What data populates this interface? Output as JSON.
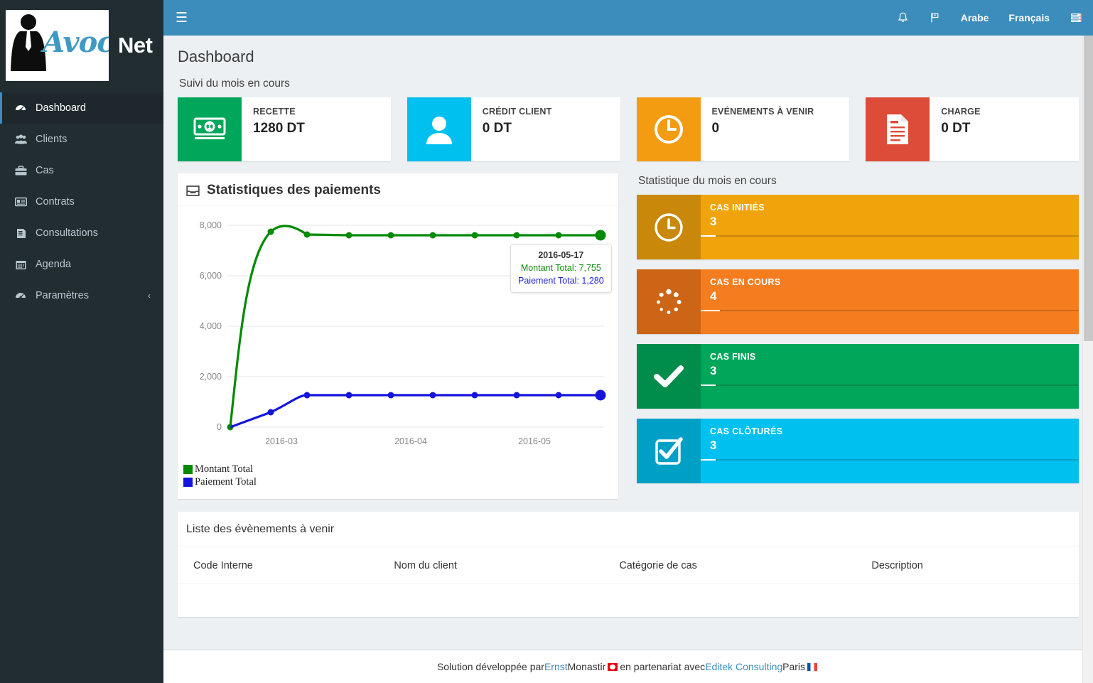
{
  "brand": {
    "script_text": "Avoca",
    "net_text": "Net"
  },
  "sidebar": {
    "items": [
      {
        "label": "Dashboard",
        "icon": "dashboard-icon",
        "active": true
      },
      {
        "label": "Clients",
        "icon": "users-icon",
        "active": false
      },
      {
        "label": "Cas",
        "icon": "briefcase-icon",
        "active": false
      },
      {
        "label": "Contrats",
        "icon": "contract-icon",
        "active": false
      },
      {
        "label": "Consultations",
        "icon": "book-icon",
        "active": false
      },
      {
        "label": "Agenda",
        "icon": "calendar-icon",
        "active": false
      },
      {
        "label": "Paramètres",
        "icon": "settings-icon",
        "active": false,
        "caret": "‹"
      }
    ]
  },
  "topbar": {
    "menu_toggle": "☰",
    "bell_icon": "bell-icon",
    "flag_icon": "flag-icon",
    "lang_arabic": "Arabe",
    "lang_french": "Français",
    "tasks_icon": "list-icon",
    "accent_color": "#3c8dbc"
  },
  "header": {
    "page_title": "Dashboard"
  },
  "suivi": {
    "section_label": "Suivi du mois en cours",
    "cards": [
      {
        "title": "RECETTE",
        "value": "1280 DT",
        "color": "#00a65a",
        "icon": "money-icon"
      },
      {
        "title": "CRÉDIT CLIENT",
        "value": "0 DT",
        "color": "#00c0ef",
        "icon": "user-icon"
      },
      {
        "title": "EVÉNEMENTS À VENIR",
        "value": "0",
        "color": "#f39c12",
        "icon": "clock-icon"
      },
      {
        "title": "CHARGE",
        "value": "0 DT",
        "color": "#dd4b39",
        "icon": "document-icon"
      }
    ]
  },
  "chart_panel": {
    "title": "Statistiques des paiements",
    "icon": "inbox-icon",
    "tooltip": {
      "date": "2016-05-17",
      "montant_label": "Montant Total: 7,755",
      "paiement_label": "Paiement Total: 1,280"
    }
  },
  "chart_data": {
    "type": "line",
    "title": "Statistiques des paiements",
    "xlabel": "",
    "ylabel": "",
    "x": [
      "2016-02-17",
      "2016-02-27",
      "2016-03-08",
      "2016-03-18",
      "2016-03-28",
      "2016-04-07",
      "2016-04-17",
      "2016-04-27",
      "2016-05-07",
      "2016-05-17"
    ],
    "xtick_labels": [
      "2016-03",
      "2016-04",
      "2016-05"
    ],
    "ytick_labels": [
      "0",
      "2,000",
      "4,000",
      "6,000",
      "8,000"
    ],
    "ylim": [
      0,
      8600
    ],
    "grid": true,
    "legend_position": "bottom-left",
    "series": [
      {
        "name": "Montant Total",
        "color": "#008a00",
        "values": [
          0,
          7600,
          7755,
          7755,
          7755,
          7755,
          7755,
          7755,
          7755,
          7755
        ]
      },
      {
        "name": "Paiement Total",
        "color": "#1414dd",
        "values": [
          0,
          600,
          1280,
          1280,
          1280,
          1280,
          1280,
          1280,
          1280,
          1280
        ]
      }
    ]
  },
  "statistique": {
    "section_label": "Statistique du mois en cours",
    "cards": [
      {
        "title": "CAS INITIÉS",
        "value": "3",
        "color": "#f0a30a",
        "icon_bg": "#c9880a",
        "icon": "clock-icon",
        "progress": 4
      },
      {
        "title": "CAS EN COURS",
        "value": "4",
        "color": "#f47d20",
        "icon_bg": "#cc6515",
        "icon": "spinner-icon",
        "progress": 5
      },
      {
        "title": "CAS FINIS",
        "value": "3",
        "color": "#00a65a",
        "icon_bg": "#008d4c",
        "icon": "check-icon",
        "progress": 4
      },
      {
        "title": "CAS CLÔTURÉS",
        "value": "3",
        "color": "#00c0ef",
        "icon_bg": "#00a0c6",
        "icon": "check-box-icon",
        "progress": 4
      }
    ]
  },
  "events_table": {
    "title": "Liste des évènements à venir",
    "columns": [
      "Code Interne",
      "Nom du client",
      "Catégorie de cas",
      "Description"
    ],
    "rows": []
  },
  "footer": {
    "text_1": "Solution développée par ",
    "link_1": "Ernst",
    "text_2": " Monastir ",
    "flag_1": "tunisia-flag",
    "text_3": " en partenariat avec ",
    "link_2": "Editek Consulting",
    "text_4": " Paris ",
    "flag_2": "france-flag"
  }
}
